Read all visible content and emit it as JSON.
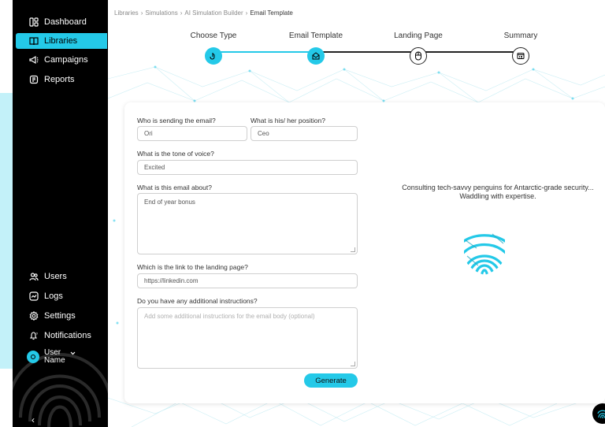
{
  "breadcrumb": [
    "Libraries",
    "Simulations",
    "AI Simulation Builder",
    "Email Template"
  ],
  "breadcrumb_separator": "›",
  "sidebar": {
    "items": [
      {
        "label": "Dashboard",
        "icon": "dashboard-icon",
        "active": false
      },
      {
        "label": "Libraries",
        "icon": "book-icon",
        "active": true
      },
      {
        "label": "Campaigns",
        "icon": "megaphone-icon",
        "active": false
      },
      {
        "label": "Reports",
        "icon": "report-icon",
        "active": false
      }
    ],
    "bottom_items": [
      {
        "label": "Users",
        "icon": "users-icon"
      },
      {
        "label": "Logs",
        "icon": "logs-icon"
      },
      {
        "label": "Settings",
        "icon": "gear-icon"
      },
      {
        "label": "Notifications",
        "icon": "bell-icon"
      }
    ],
    "user": {
      "line1": "User",
      "line2": "Name"
    },
    "collapse_label": "‹"
  },
  "stepper": {
    "steps": [
      {
        "label": "Choose Type",
        "icon": "pointer-icon",
        "done": true
      },
      {
        "label": "Email Template",
        "icon": "envelope-icon",
        "done": true
      },
      {
        "label": "Landing Page",
        "icon": "mouse-icon",
        "done": false
      },
      {
        "label": "Summary",
        "icon": "summary-icon",
        "done": false
      }
    ]
  },
  "form": {
    "sender_label": "Who is sending the email?",
    "sender_value": "Ori",
    "position_label": "What is his/ her position?",
    "position_value": "Ceo",
    "tone_label": "What is the tone of voice?",
    "tone_value": "Excited",
    "about_label": "What is this email about?",
    "about_value": "End of year bonus",
    "link_label": "Which is the link to the landing page?",
    "link_value": "https://linkedin.com",
    "instructions_label": "Do you have any additional instructions?",
    "instructions_placeholder": "Add some additional instructions for the email body (optional)",
    "generate_label": "Generate"
  },
  "tagline": "Consulting tech-savvy penguins for Antarctic-grade security... Waddling with expertise.",
  "colors": {
    "accent": "#24c9e8",
    "sidebar_bg": "#000000",
    "accent_light": "#c3f1f9"
  }
}
